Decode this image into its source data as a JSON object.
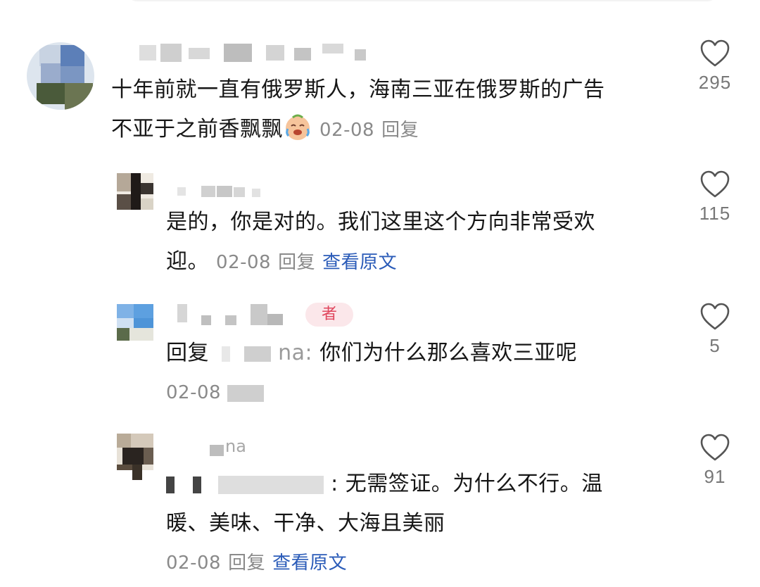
{
  "comments": [
    {
      "text_lines": [
        "十年前就一直有俄罗斯人，海南三亚在俄罗斯的广告",
        "不亚于之前香飘飘"
      ],
      "emoji": "crying-laughing-emoji",
      "date": "02-08",
      "reply": "回复",
      "likes": "295"
    },
    {
      "text_lines": [
        "是的，你是对的。我们这里这个方向非常受欢",
        "迎。"
      ],
      "date": "02-08",
      "reply": "回复",
      "view_original": "查看原文",
      "likes": "115"
    },
    {
      "author_tag": "者",
      "reply_prefix": "回复",
      "reply_target_suffix": "na:",
      "text": "你们为什么那么喜欢三亚呢",
      "date": "02-08",
      "reply": "回复",
      "likes": "5"
    },
    {
      "name_fragment": "na",
      "text_lines": [
        ": 无需签证。为什么不行。温",
        "暖、美味、干净、大海且美丽"
      ],
      "date": "02-08",
      "reply": "回复",
      "view_original": "查看原文",
      "likes": "91"
    }
  ],
  "icons": {
    "like": "heart-outline-icon"
  },
  "colors": {
    "link": "#2a5bb8",
    "meta": "#8a8a8a",
    "author_tag_bg": "#fbe7ea",
    "author_tag_text": "#e0475e"
  }
}
